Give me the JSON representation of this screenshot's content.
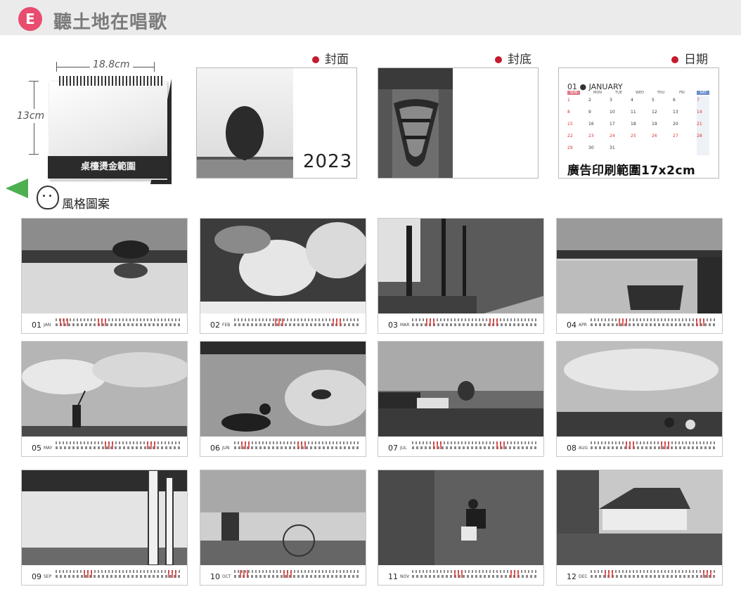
{
  "header": {
    "badge": "E",
    "title": "聽土地在唱歌"
  },
  "product": {
    "width_label": "18.8cm",
    "height_label": "13cm",
    "band_text": "桌檯燙金範圍"
  },
  "style_label": "風格圖案",
  "previews": {
    "cover": {
      "label": "封面",
      "year": "2023"
    },
    "back": {
      "label": "封底"
    },
    "date": {
      "label": "日期",
      "month_header": "01 ● JANUARY",
      "weekdays": [
        "SUN",
        "MON",
        "TUE",
        "WED",
        "THU",
        "FRI",
        "SAT"
      ],
      "weeks": [
        [
          "1",
          "2",
          "3",
          "4",
          "5",
          "6",
          "7"
        ],
        [
          "8",
          "9",
          "10",
          "11",
          "12",
          "13",
          "14"
        ],
        [
          "15",
          "16",
          "17",
          "18",
          "19",
          "20",
          "21"
        ],
        [
          "22",
          "23",
          "24",
          "25",
          "26",
          "27",
          "28"
        ],
        [
          "29",
          "30",
          "31",
          "",
          "",
          "",
          ""
        ]
      ],
      "ad_text": "廣告印刷範圍17x2cm"
    }
  },
  "months": [
    {
      "num": "01",
      "abbr": "JAN"
    },
    {
      "num": "02",
      "abbr": "FEB"
    },
    {
      "num": "03",
      "abbr": "MAR"
    },
    {
      "num": "04",
      "abbr": "APR"
    },
    {
      "num": "05",
      "abbr": "MAY"
    },
    {
      "num": "06",
      "abbr": "JUN"
    },
    {
      "num": "07",
      "abbr": "JUL"
    },
    {
      "num": "08",
      "abbr": "AUG"
    },
    {
      "num": "09",
      "abbr": "SEP"
    },
    {
      "num": "10",
      "abbr": "OCT"
    },
    {
      "num": "11",
      "abbr": "NOV"
    },
    {
      "num": "12",
      "abbr": "DEC"
    }
  ],
  "colors": {
    "badge": "#e84c6f",
    "dot": "#c51a2d",
    "sunday_header": "#e07b8a",
    "saturday_header": "#6b8fc9",
    "holiday_red": "#dd3333"
  }
}
